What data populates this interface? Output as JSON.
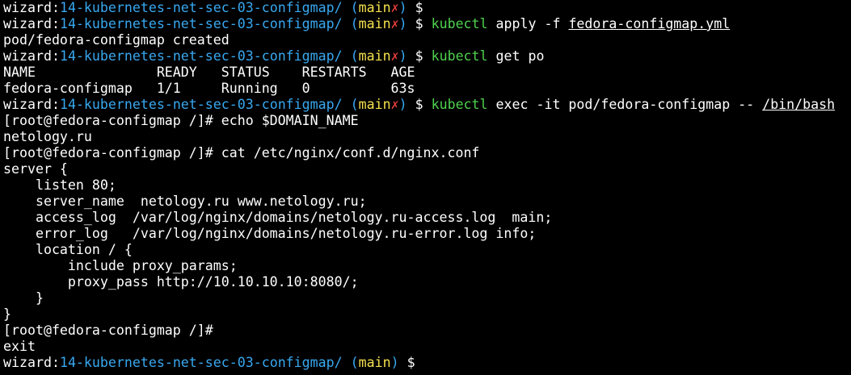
{
  "prompt": {
    "user": "wizard",
    "sep": ":",
    "path": "14-kubernetes-net-sec-03-configmap/",
    "git_open": "(",
    "branch": "main",
    "dirty_mark": "✗",
    "git_close": ")",
    "symbol": "$"
  },
  "lines": {
    "l1": {
      "cmd": "kubectl",
      "args_pre": " apply -f ",
      "arg_link": "fedora-configmap.yml"
    },
    "l2": {
      "text": "pod/fedora-configmap created"
    },
    "l3": {
      "cmd": "kubectl",
      "args_pre": " get po"
    },
    "l4": {
      "text": "NAME               READY   STATUS    RESTARTS   AGE"
    },
    "l5": {
      "text": "fedora-configmap   1/1     Running   0          63s"
    },
    "l6": {
      "cmd": "kubectl",
      "args_pre": " exec -it pod/fedora-configmap -- ",
      "arg_link": "/bin/bash"
    },
    "l7": {
      "text": "[root@fedora-configmap /]# echo $DOMAIN_NAME"
    },
    "l8": {
      "text": "netology.ru"
    },
    "l9": {
      "text": "[root@fedora-configmap /]# cat /etc/nginx/conf.d/nginx.conf"
    },
    "l10": {
      "text": "server {"
    },
    "l11": {
      "text": "    listen 80;"
    },
    "l12": {
      "text": "    server_name  netology.ru www.netology.ru;"
    },
    "l13": {
      "text": "    access_log  /var/log/nginx/domains/netology.ru-access.log  main;"
    },
    "l14": {
      "text": "    error_log   /var/log/nginx/domains/netology.ru-error.log info;"
    },
    "l15": {
      "text": "    location / {"
    },
    "l16": {
      "text": "        include proxy_params;"
    },
    "l17": {
      "text": "        proxy_pass http://10.10.10.10:8080/;"
    },
    "l18": {
      "text": "    }"
    },
    "l19": {
      "text": "}"
    },
    "l20": {
      "text": "[root@fedora-configmap /]#"
    },
    "l21": {
      "text": "exit"
    }
  },
  "colors": {
    "background": "#000000",
    "text": "#ffffff",
    "path": "#38a8f0",
    "branch": "#f5e04e",
    "dirty": "#e23c3c",
    "command": "#4fd14f"
  }
}
